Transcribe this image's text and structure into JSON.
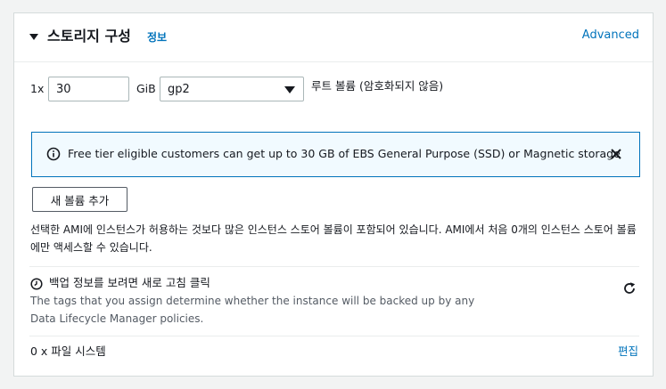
{
  "header": {
    "title": "스토리지 구성",
    "info_link": "정보",
    "advanced_link": "Advanced"
  },
  "volume": {
    "count_label": "1x",
    "size_value": "30",
    "size_unit": "GiB",
    "type_value": "gp2",
    "root_label": "루트 볼륨  (암호화되지 않음)"
  },
  "alert": {
    "text": "Free tier eligible customers can get up to 30 GB of EBS General Purpose (SSD) or Magnetic storage"
  },
  "add_volume_button": "새 볼륨 추가",
  "description": "선택한 AMI에 인스턴스가 허용하는 것보다 많은 인스턴스 스토어 볼륨이 포함되어 있습니다. AMI에서 처음 0개의 인스턴스 스토어 볼륨에만 액세스할 수 있습니다.",
  "backup": {
    "title": "백업 정보를 보려면 새로 고침 클릭",
    "description": "The tags that you assign determine whether the instance will be backed up by any Data Lifecycle Manager policies."
  },
  "file_systems": {
    "label": "0 x 파일 시스템",
    "edit_link": "편집"
  },
  "colors": {
    "link": "#0073bb",
    "alert_bg": "#f1faff",
    "alert_border": "#0073bb",
    "text": "#16191f",
    "muted": "#545b64"
  }
}
